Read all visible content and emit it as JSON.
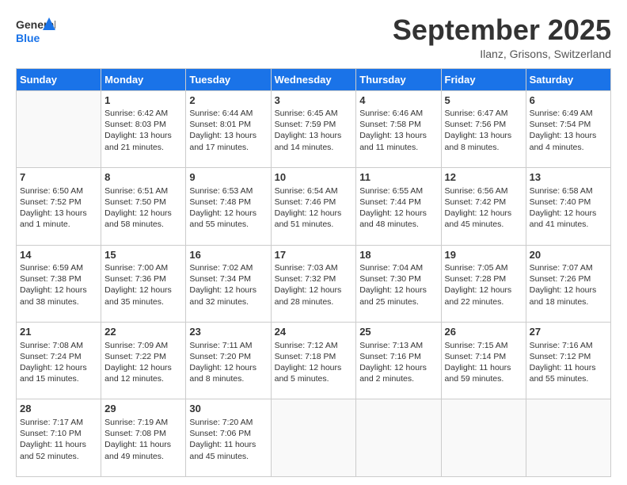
{
  "header": {
    "logo_general": "General",
    "logo_blue": "Blue",
    "month_title": "September 2025",
    "location": "Ilanz, Grisons, Switzerland"
  },
  "days_of_week": [
    "Sunday",
    "Monday",
    "Tuesday",
    "Wednesday",
    "Thursday",
    "Friday",
    "Saturday"
  ],
  "weeks": [
    [
      {
        "day": "",
        "info": ""
      },
      {
        "day": "1",
        "info": "Sunrise: 6:42 AM\nSunset: 8:03 PM\nDaylight: 13 hours\nand 21 minutes."
      },
      {
        "day": "2",
        "info": "Sunrise: 6:44 AM\nSunset: 8:01 PM\nDaylight: 13 hours\nand 17 minutes."
      },
      {
        "day": "3",
        "info": "Sunrise: 6:45 AM\nSunset: 7:59 PM\nDaylight: 13 hours\nand 14 minutes."
      },
      {
        "day": "4",
        "info": "Sunrise: 6:46 AM\nSunset: 7:58 PM\nDaylight: 13 hours\nand 11 minutes."
      },
      {
        "day": "5",
        "info": "Sunrise: 6:47 AM\nSunset: 7:56 PM\nDaylight: 13 hours\nand 8 minutes."
      },
      {
        "day": "6",
        "info": "Sunrise: 6:49 AM\nSunset: 7:54 PM\nDaylight: 13 hours\nand 4 minutes."
      }
    ],
    [
      {
        "day": "7",
        "info": "Sunrise: 6:50 AM\nSunset: 7:52 PM\nDaylight: 13 hours\nand 1 minute."
      },
      {
        "day": "8",
        "info": "Sunrise: 6:51 AM\nSunset: 7:50 PM\nDaylight: 12 hours\nand 58 minutes."
      },
      {
        "day": "9",
        "info": "Sunrise: 6:53 AM\nSunset: 7:48 PM\nDaylight: 12 hours\nand 55 minutes."
      },
      {
        "day": "10",
        "info": "Sunrise: 6:54 AM\nSunset: 7:46 PM\nDaylight: 12 hours\nand 51 minutes."
      },
      {
        "day": "11",
        "info": "Sunrise: 6:55 AM\nSunset: 7:44 PM\nDaylight: 12 hours\nand 48 minutes."
      },
      {
        "day": "12",
        "info": "Sunrise: 6:56 AM\nSunset: 7:42 PM\nDaylight: 12 hours\nand 45 minutes."
      },
      {
        "day": "13",
        "info": "Sunrise: 6:58 AM\nSunset: 7:40 PM\nDaylight: 12 hours\nand 41 minutes."
      }
    ],
    [
      {
        "day": "14",
        "info": "Sunrise: 6:59 AM\nSunset: 7:38 PM\nDaylight: 12 hours\nand 38 minutes."
      },
      {
        "day": "15",
        "info": "Sunrise: 7:00 AM\nSunset: 7:36 PM\nDaylight: 12 hours\nand 35 minutes."
      },
      {
        "day": "16",
        "info": "Sunrise: 7:02 AM\nSunset: 7:34 PM\nDaylight: 12 hours\nand 32 minutes."
      },
      {
        "day": "17",
        "info": "Sunrise: 7:03 AM\nSunset: 7:32 PM\nDaylight: 12 hours\nand 28 minutes."
      },
      {
        "day": "18",
        "info": "Sunrise: 7:04 AM\nSunset: 7:30 PM\nDaylight: 12 hours\nand 25 minutes."
      },
      {
        "day": "19",
        "info": "Sunrise: 7:05 AM\nSunset: 7:28 PM\nDaylight: 12 hours\nand 22 minutes."
      },
      {
        "day": "20",
        "info": "Sunrise: 7:07 AM\nSunset: 7:26 PM\nDaylight: 12 hours\nand 18 minutes."
      }
    ],
    [
      {
        "day": "21",
        "info": "Sunrise: 7:08 AM\nSunset: 7:24 PM\nDaylight: 12 hours\nand 15 minutes."
      },
      {
        "day": "22",
        "info": "Sunrise: 7:09 AM\nSunset: 7:22 PM\nDaylight: 12 hours\nand 12 minutes."
      },
      {
        "day": "23",
        "info": "Sunrise: 7:11 AM\nSunset: 7:20 PM\nDaylight: 12 hours\nand 8 minutes."
      },
      {
        "day": "24",
        "info": "Sunrise: 7:12 AM\nSunset: 7:18 PM\nDaylight: 12 hours\nand 5 minutes."
      },
      {
        "day": "25",
        "info": "Sunrise: 7:13 AM\nSunset: 7:16 PM\nDaylight: 12 hours\nand 2 minutes."
      },
      {
        "day": "26",
        "info": "Sunrise: 7:15 AM\nSunset: 7:14 PM\nDaylight: 11 hours\nand 59 minutes."
      },
      {
        "day": "27",
        "info": "Sunrise: 7:16 AM\nSunset: 7:12 PM\nDaylight: 11 hours\nand 55 minutes."
      }
    ],
    [
      {
        "day": "28",
        "info": "Sunrise: 7:17 AM\nSunset: 7:10 PM\nDaylight: 11 hours\nand 52 minutes."
      },
      {
        "day": "29",
        "info": "Sunrise: 7:19 AM\nSunset: 7:08 PM\nDaylight: 11 hours\nand 49 minutes."
      },
      {
        "day": "30",
        "info": "Sunrise: 7:20 AM\nSunset: 7:06 PM\nDaylight: 11 hours\nand 45 minutes."
      },
      {
        "day": "",
        "info": ""
      },
      {
        "day": "",
        "info": ""
      },
      {
        "day": "",
        "info": ""
      },
      {
        "day": "",
        "info": ""
      }
    ]
  ]
}
